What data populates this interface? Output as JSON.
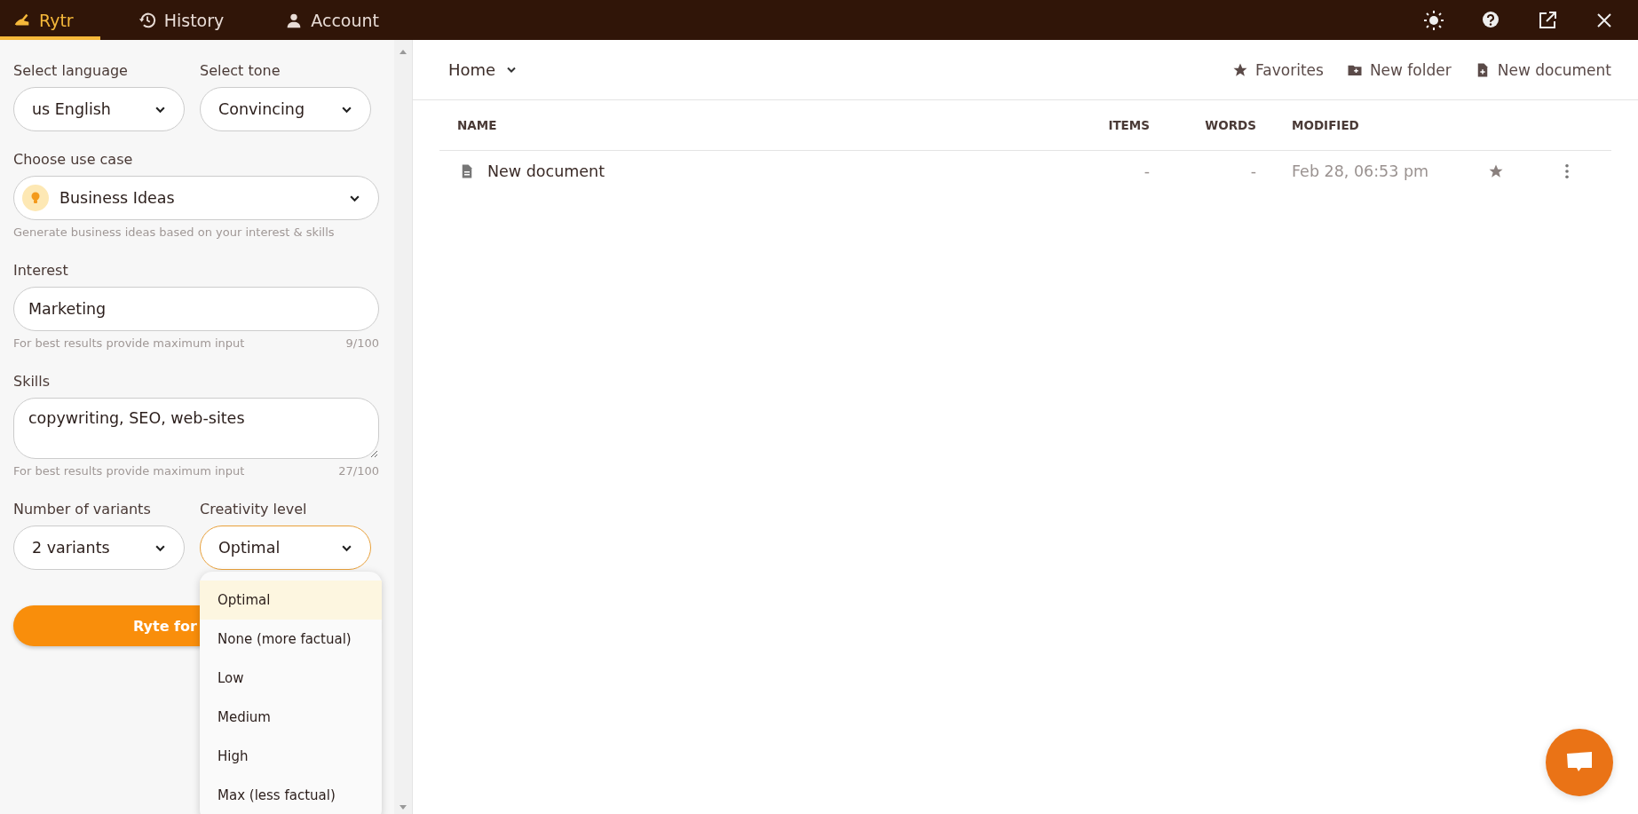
{
  "top_bar": {
    "tabs": [
      {
        "label": "Rytr",
        "selected": true
      },
      {
        "label": "History",
        "selected": false
      },
      {
        "label": "Account",
        "selected": false
      }
    ]
  },
  "form": {
    "language": {
      "label": "Select language",
      "value": "us English"
    },
    "tone": {
      "label": "Select tone",
      "value": "Convincing"
    },
    "use_case": {
      "label": "Choose use case",
      "value": "Business Ideas",
      "hint": "Generate business ideas based on your interest & skills"
    },
    "interest": {
      "label": "Interest",
      "value": "Marketing",
      "hint": "For best results provide maximum input",
      "count": "9/100"
    },
    "skills": {
      "label": "Skills",
      "value": "copywriting, SEO, web-sites",
      "hint": "For best results provide maximum input",
      "count": "27/100"
    },
    "variants": {
      "label": "Number of variants",
      "value": "2 variants"
    },
    "creativity": {
      "label": "Creativity level",
      "value": "Optimal",
      "expanded": true,
      "options": [
        {
          "label": "Optimal",
          "selected": true
        },
        {
          "label": "None (more factual)",
          "selected": false
        },
        {
          "label": "Low",
          "selected": false
        },
        {
          "label": "Medium",
          "selected": false
        },
        {
          "label": "High",
          "selected": false
        },
        {
          "label": "Max (less factual)",
          "selected": false
        }
      ]
    },
    "submit_button": "Ryte for"
  },
  "documents": {
    "folder": "Home",
    "actions": [
      {
        "label": "Favorites"
      },
      {
        "label": "New folder"
      },
      {
        "label": "New document"
      }
    ],
    "columns": [
      "NAME",
      "ITEMS",
      "WORDS",
      "MODIFIED"
    ],
    "rows": [
      {
        "name": "New document",
        "items": "-",
        "words": "-",
        "modified": "Feb 28, 06:53 pm",
        "favorite": false
      }
    ]
  }
}
